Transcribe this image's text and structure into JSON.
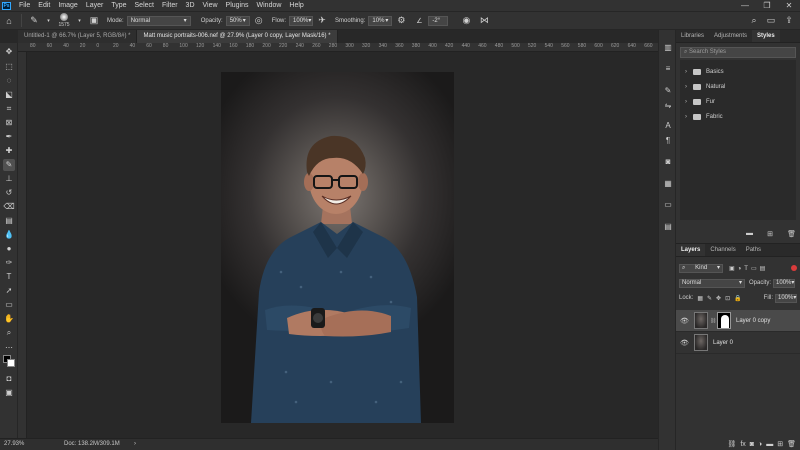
{
  "app": {
    "menu": [
      "File",
      "Edit",
      "Image",
      "Layer",
      "Type",
      "Select",
      "Filter",
      "3D",
      "View",
      "Plugins",
      "Window",
      "Help"
    ],
    "window_controls": [
      "—",
      "❐",
      "✕"
    ]
  },
  "options_bar": {
    "brush_size": "1575",
    "mode_label": "Mode:",
    "mode_value": "Normal",
    "opacity_label": "Opacity:",
    "opacity_value": "50%",
    "flow_label": "Flow:",
    "flow_value": "100%",
    "smoothing_label": "Smoothing:",
    "smoothing_value": "10%",
    "angle_value": "-2°"
  },
  "tabs": [
    {
      "label": "Untitled-1 @ 66.7% (Layer 5, RGB/8#) *",
      "active": false
    },
    {
      "label": "Matt music portraits-006.nef @ 27.9% (Layer 0 copy, Layer Mask/16) *",
      "active": true
    }
  ],
  "ruler": {
    "ticks": [
      "80",
      "60",
      "40",
      "20",
      "0",
      "20",
      "40",
      "60",
      "80",
      "100",
      "120",
      "140",
      "160",
      "180",
      "200",
      "220",
      "240",
      "260",
      "280",
      "300",
      "320",
      "340",
      "360",
      "380",
      "400",
      "420",
      "440",
      "460",
      "480",
      "500",
      "520",
      "540",
      "560",
      "580",
      "600",
      "620",
      "640",
      "660"
    ]
  },
  "status": {
    "zoom": "27.93%",
    "doc": "Doc: 138.2M/309.1M"
  },
  "top_panel": {
    "tabs": [
      "Libraries",
      "Adjustments",
      "Styles"
    ],
    "search_placeholder": "Search Styles",
    "groups": [
      "Basics",
      "Natural",
      "Fur",
      "Fabric"
    ]
  },
  "layers_panel": {
    "tabs": [
      "Layers",
      "Channels",
      "Paths"
    ],
    "kind_label": "Kind",
    "blend_mode": "Normal",
    "opacity_label": "Opacity:",
    "opacity_value": "100%",
    "lock_label": "Lock:",
    "fill_label": "Fill:",
    "fill_value": "100%",
    "layers": [
      {
        "name": "Layer 0 copy",
        "selected": true,
        "has_mask": true
      },
      {
        "name": "Layer 0",
        "selected": false,
        "has_mask": false
      }
    ]
  },
  "colors": {
    "accent": "#31a8ff",
    "panel_bg": "#323232",
    "canvas_bg": "#282828",
    "shirt": "#26405a"
  }
}
